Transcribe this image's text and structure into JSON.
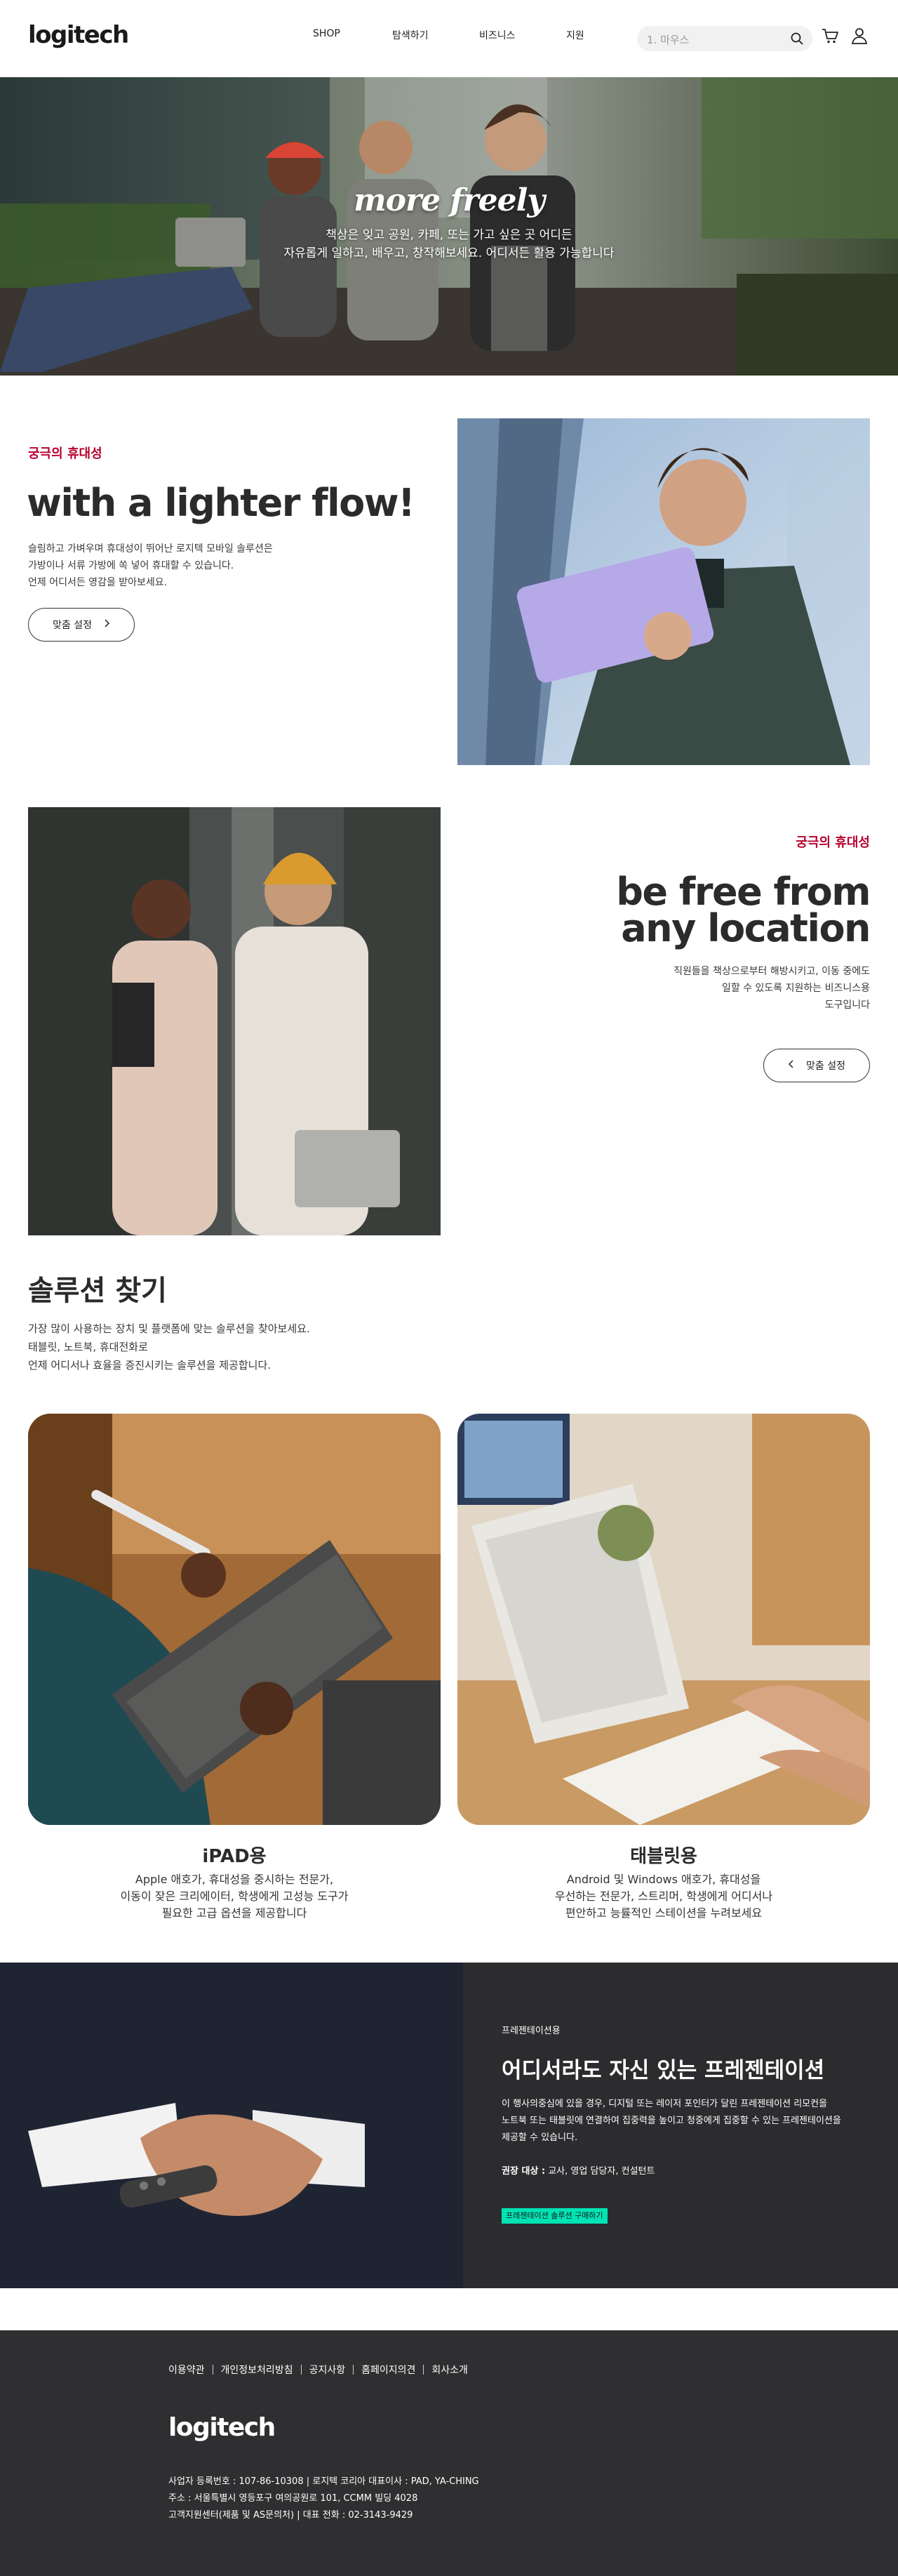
{
  "header": {
    "logo": "logitech",
    "nav": [
      "SHOP",
      "탐색하기",
      "비즈니스",
      "지원"
    ],
    "search_placeholder": "1. 마우스"
  },
  "hero": {
    "title_main": "more ",
    "title_italic": "freely",
    "subtitle_1": "책상은 잊고 공원, 카페, 또는 가고 싶은 곳 어디든",
    "subtitle_2": "자유롭게 일하고, 배우고, 창작해보세요. 어디서든 활용 가능합니다"
  },
  "section1": {
    "eyebrow": "궁극의 휴대성",
    "heading": "with a lighter flow!",
    "body_1": "슬림하고 가벼우며 휴대성이 뛰어난 로지텍 모바일 솔루션은",
    "body_2": "가방이나 서류 가방에 쏙 넣어 휴대할 수 있습니다.",
    "body_3": "언제 어디서든 영감을 받아보세요.",
    "button": "맞춤 설정"
  },
  "section2": {
    "eyebrow": "궁극의 휴대성",
    "heading_1": "be free from",
    "heading_2": "any location",
    "body_1": "직원들을 책상으로부터 해방시키고, 이동 중에도",
    "body_2": "일할 수 있도록 지원하는 비즈니스용",
    "body_3": "도구입니다",
    "button": "맞춤 설정"
  },
  "solutions": {
    "title": "솔루션 찾기",
    "body_1": "가장 많이 사용하는 장치 및 플랫폼에 맞는 솔루션을 찾아보세요.",
    "body_2": "태블릿, 노트북, 휴대전화로",
    "body_3": "언제 어디서나 효율을 증진시키는 솔루션을 제공합니다.",
    "cards": [
      {
        "title": "iPAD용",
        "desc_1": "Apple 애호가, 휴대성을 중시하는 전문가,",
        "desc_2": "이동이 잦은 크리에이터, 학생에게 고성능 도구가",
        "desc_3": "필요한 고급 옵션을 제공합니다"
      },
      {
        "title": "태블릿용",
        "desc_1": "Android 및 Windows 애호가, 휴대성을",
        "desc_2": "우선하는 전문가, 스트리머, 학생에게 어디서나",
        "desc_3": "편안하고 능률적인 스테이션을 누려보세요"
      }
    ]
  },
  "presentation": {
    "eyebrow": "프레젠테이션용",
    "title": "어디서라도 자신 있는 프레젠테이션",
    "body_1": "이 행사의중심에 있을 경우, 디지털 또는 레이저 포인터가 달린 프레젠테이션 리모컨을",
    "body_2": "노트북 또는 태블릿에 연결하여 집중력을 높이고 청중에게 집중할 수 있는 프레젠테이션을",
    "body_3": "제공할 수 있습니다.",
    "target_label": "권장 대상 :",
    "target_value": " 교사, 영업 담당자, 컨설턴트",
    "button": "프레젠테이션 솔루션 구매하기"
  },
  "footer": {
    "links": [
      "이용약관",
      "개인정보처리방침",
      "공지사항",
      "홈페이지의견",
      "회사소개"
    ],
    "logo": "logitech",
    "info_1": "사업자 등록번호 : 107-86-10308  |  로지텍 코리아 대표이사 : PAD, YA-CHING",
    "info_2": "주소 : 서울특별시 영등포구 여의공원로 101, CCMM 빌딩 4028",
    "info_3": "고객지원센터(제품 및 AS문의처)  |  대표 전화 : 02-3143-9429"
  },
  "colors": {
    "accent_red": "#b8002c",
    "mint": "#00e3b4",
    "dark": "#2c2c2f"
  }
}
